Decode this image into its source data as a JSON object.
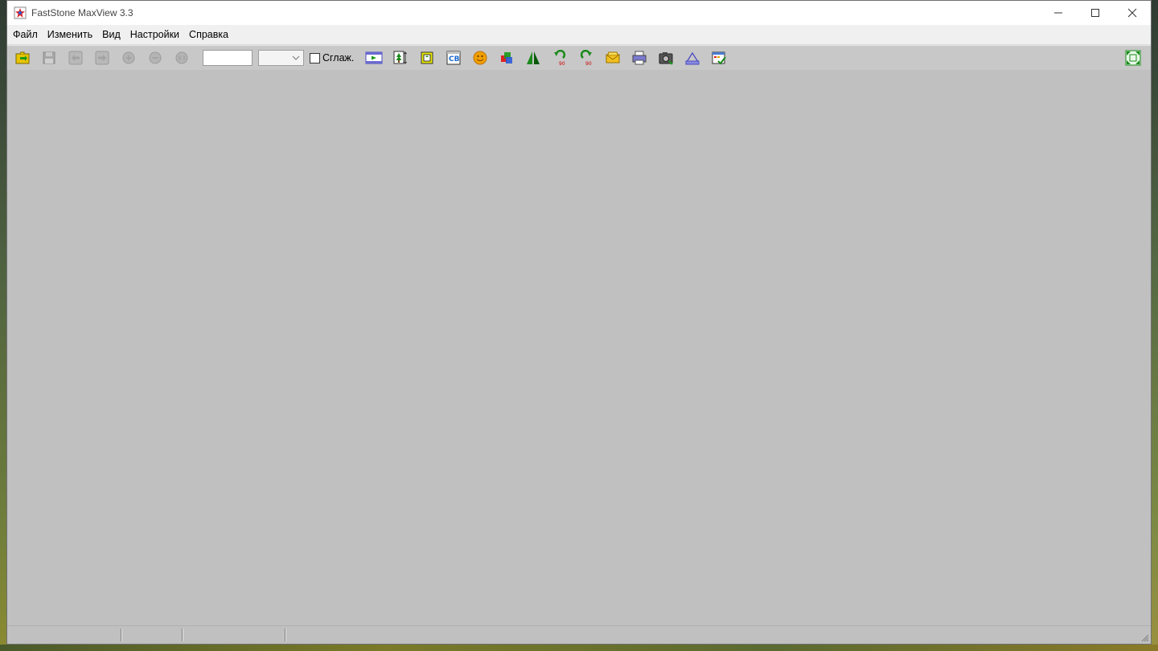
{
  "window": {
    "title": "FastStone MaxView 3.3"
  },
  "menu": {
    "items": [
      {
        "label": "Файл"
      },
      {
        "label": "Изменить"
      },
      {
        "label": "Вид"
      },
      {
        "label": "Настройки"
      },
      {
        "label": "Справка"
      }
    ]
  },
  "toolbar": {
    "zoom_input_value": "",
    "zoom_select_value": "",
    "smooth_checkbox_label": "Сглаж.",
    "smooth_checked": false,
    "buttons": [
      {
        "icon": "open-folder-icon",
        "enabled": true
      },
      {
        "icon": "save-icon",
        "enabled": false
      },
      {
        "icon": "previous-icon",
        "enabled": false
      },
      {
        "icon": "next-icon",
        "enabled": false
      },
      {
        "icon": "zoom-in-icon",
        "enabled": false
      },
      {
        "icon": "zoom-out-icon",
        "enabled": false
      },
      {
        "icon": "actual-size-icon",
        "enabled": false
      },
      {
        "icon": "slideshow-icon",
        "enabled": true
      },
      {
        "icon": "resize-icon",
        "enabled": true
      },
      {
        "icon": "crop-icon",
        "enabled": true
      },
      {
        "icon": "color-adjust-icon",
        "enabled": true
      },
      {
        "icon": "effects-icon",
        "enabled": true
      },
      {
        "icon": "color-balance-icon",
        "enabled": true
      },
      {
        "icon": "flip-icon",
        "enabled": true
      },
      {
        "icon": "rotate-left-icon",
        "enabled": true
      },
      {
        "icon": "rotate-right-icon",
        "enabled": true
      },
      {
        "icon": "email-icon",
        "enabled": true
      },
      {
        "icon": "print-icon",
        "enabled": true
      },
      {
        "icon": "screen-capture-icon",
        "enabled": true
      },
      {
        "icon": "scanner-icon",
        "enabled": true
      },
      {
        "icon": "settings-icon",
        "enabled": true
      },
      {
        "icon": "fullscreen-icon",
        "enabled": true
      }
    ]
  },
  "statusbar": {
    "panels": [
      "",
      "",
      ""
    ]
  },
  "colors": {
    "client_bg": "#c0c0c0",
    "toolbar_bg": "#c8c8c8",
    "menubar_bg": "#f0f0f0",
    "titlebar_bg": "#ffffff"
  }
}
